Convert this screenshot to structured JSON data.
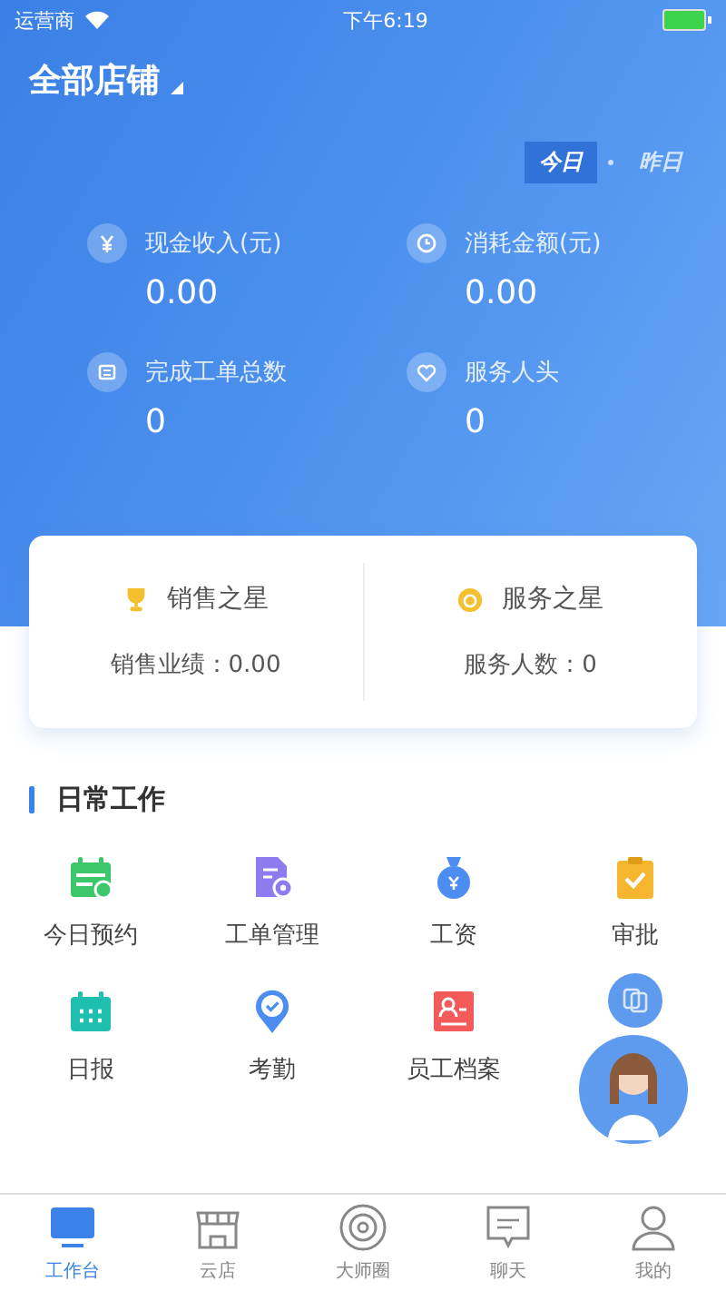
{
  "status_bar": {
    "carrier": "运营商",
    "time": "下午6:19"
  },
  "store_selector": {
    "label": "全部店铺"
  },
  "periods": [
    {
      "label": "今日",
      "selected": true
    },
    {
      "label": "昨日",
      "selected": false
    }
  ],
  "stats": [
    {
      "kind": "yuan",
      "label": "现金收入(元)",
      "value": "0.00"
    },
    {
      "kind": "clock",
      "label": "消耗金额(元)",
      "value": "0.00"
    },
    {
      "kind": "order",
      "label": "完成工单总数",
      "value": "0"
    },
    {
      "kind": "heart",
      "label": "服务人头",
      "value": "0"
    }
  ],
  "stars": [
    {
      "kind": "trophy",
      "title": "销售之星",
      "text": "销售业绩：0.00"
    },
    {
      "kind": "medal",
      "title": "服务之星",
      "text": "服务人数：0"
    }
  ],
  "section": {
    "title": "日常工作",
    "items": [
      {
        "kind": "calendar-check",
        "label": "今日预约"
      },
      {
        "kind": "doc-gear",
        "label": "工单管理"
      },
      {
        "kind": "moneybag",
        "label": "工资"
      },
      {
        "kind": "clipboard",
        "label": "审批"
      },
      {
        "kind": "calendar-grid",
        "label": "日报"
      },
      {
        "kind": "pin",
        "label": "考勤"
      },
      {
        "kind": "profile",
        "label": "员工档案"
      }
    ]
  },
  "tabs": [
    {
      "kind": "monitor",
      "label": "工作台",
      "selected": true
    },
    {
      "kind": "shop",
      "label": "云店",
      "selected": false
    },
    {
      "kind": "disc",
      "label": "大师圈",
      "selected": false
    },
    {
      "kind": "chat",
      "label": "聊天",
      "selected": false
    },
    {
      "kind": "person",
      "label": "我的",
      "selected": false
    }
  ]
}
